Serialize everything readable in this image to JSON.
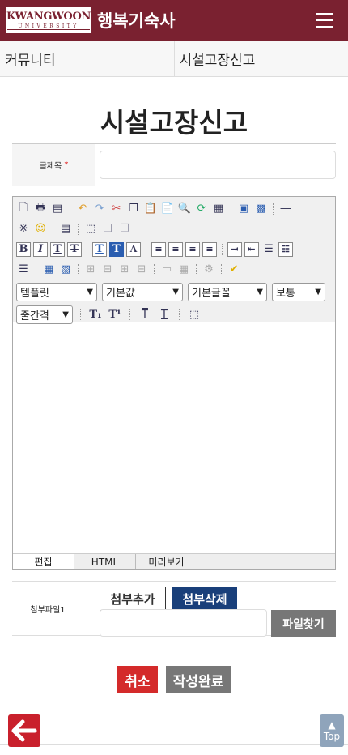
{
  "header": {
    "logo_text": "KWANGWOON",
    "logo_sub": "UNIVERSITY",
    "brand": "행복기숙사",
    "menu_icon": "hamburger-menu-icon"
  },
  "nav": {
    "left": "커뮤니티",
    "right": "시설고장신고"
  },
  "page": {
    "title": "시설고장신고"
  },
  "form": {
    "title_label": "글제목",
    "required_mark": "*",
    "title_value": "",
    "attach_label": "첨부파일1",
    "attach_add": "첨부추가",
    "attach_delete": "첨부삭제",
    "file_find": "파일찾기",
    "file_value": ""
  },
  "editor": {
    "select_template": "템플릿",
    "select_default": "기본값",
    "select_font": "기본글꼴",
    "select_size": "보통",
    "select_lineheight": "줄간격",
    "tab_edit": "편집",
    "tab_html": "HTML",
    "tab_preview": "미리보기"
  },
  "actions": {
    "cancel": "취소",
    "submit": "작성완료"
  },
  "footer": {
    "top_label": "Top"
  },
  "colors": {
    "header_bg": "#7a2130",
    "cancel_bg": "#d42a2a",
    "delete_bg": "#193f7a",
    "back_bg": "#c9202c"
  }
}
